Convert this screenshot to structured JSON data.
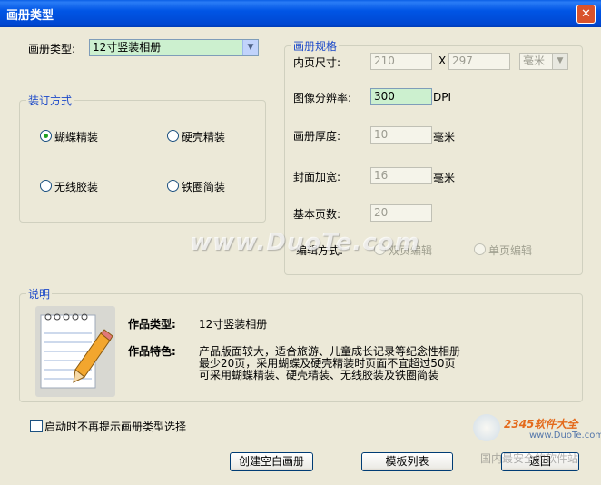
{
  "window": {
    "title": "画册类型",
    "close_glyph": "✕"
  },
  "album_type": {
    "label": "画册类型:",
    "value": "12寸竖装相册"
  },
  "binding": {
    "group_label": "装订方式",
    "options": [
      {
        "label": "蝴蝶精装",
        "selected": true
      },
      {
        "label": "硬壳精装",
        "selected": false
      },
      {
        "label": "无线胶装",
        "selected": false
      },
      {
        "label": "铁圈简装",
        "selected": false
      }
    ]
  },
  "specs": {
    "group_label": "画册规格",
    "inner_size_label": "内页尺寸:",
    "width": "210",
    "x_sep": "X",
    "height": "297",
    "unit_select": "毫米",
    "resolution_label": "图像分辨率:",
    "resolution": "300",
    "resolution_unit": "DPI",
    "thickness_label": "画册厚度:",
    "thickness": "10",
    "thickness_unit": "毫米",
    "cover_label": "封面加宽:",
    "cover": "16",
    "cover_unit": "毫米",
    "pages_label": "基本页数:",
    "pages": "20",
    "edit_mode_label": "编辑方式:",
    "edit_double": "双页编辑",
    "edit_single": "单页编辑"
  },
  "description": {
    "group_label": "说明",
    "type_label": "作品类型:",
    "type_value": "12寸竖装相册",
    "feature_label": "作品特色:",
    "feature_lines": [
      "产品版面较大，适合旅游、儿童成长记录等纪念性相册",
      "最少20页，采用蝴蝶及硬壳精装时页面不宜超过50页",
      "可采用蝴蝶精装、硬壳精装、无线胶装及铁圈简装"
    ]
  },
  "startup_checkbox": {
    "label": "启动时不再提示画册类型选择",
    "checked": false
  },
  "buttons": {
    "create_blank": "创建空白画册",
    "template_list": "模板列表",
    "back": "返回"
  },
  "watermarks": {
    "center": "www.DuoTe.com",
    "corner_brand": "2345软件大全",
    "corner_url": "www.DuoTe.com",
    "corner_text": "国内最安全的软件站"
  },
  "colors": {
    "titlebar": "#0055e5",
    "group_label": "#1c49c9",
    "active_input": "#ccf0cf",
    "dialog_bg": "#ece9d8"
  }
}
